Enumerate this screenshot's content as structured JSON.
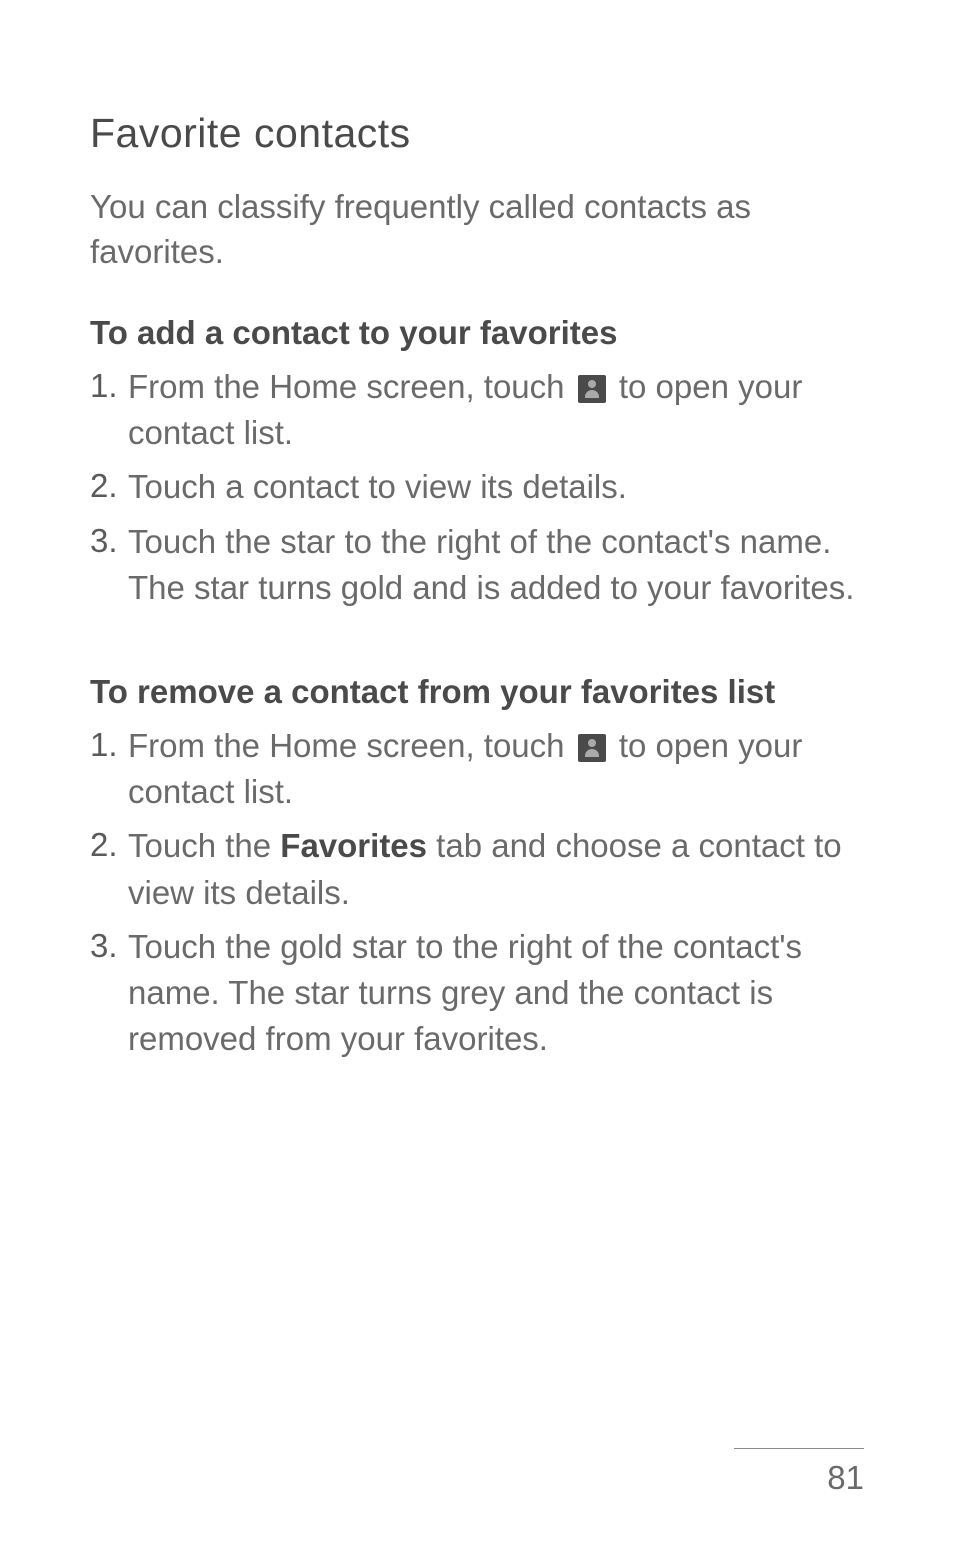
{
  "main_heading": "Favorite contacts",
  "intro": "You can classify frequently called contacts as favorites.",
  "section_add": {
    "heading": "To add a contact to your favorites",
    "item1_num": "1.",
    "item1_a": "From the Home screen, touch ",
    "item1_b": " to open your contact list.",
    "item2_num": "2.",
    "item2": "Touch a contact to view its details.",
    "item3_num": "3.",
    "item3": "Touch the star to the right of the contact's name. The star turns gold and is added to your favorites."
  },
  "section_remove": {
    "heading": "To remove a contact from your favorites list",
    "item1_num": "1.",
    "item1_a": "From the Home screen, touch ",
    "item1_b": " to open your contact list.",
    "item2_num": "2.",
    "item2_a": "Touch the ",
    "item2_bold": "Favorites",
    "item2_b": " tab and choose a contact to view its details.",
    "item3_num": "3.",
    "item3": "Touch the gold star to the right of the contact's name. The star turns grey and the contact is removed from your favorites."
  },
  "page_number": "81"
}
